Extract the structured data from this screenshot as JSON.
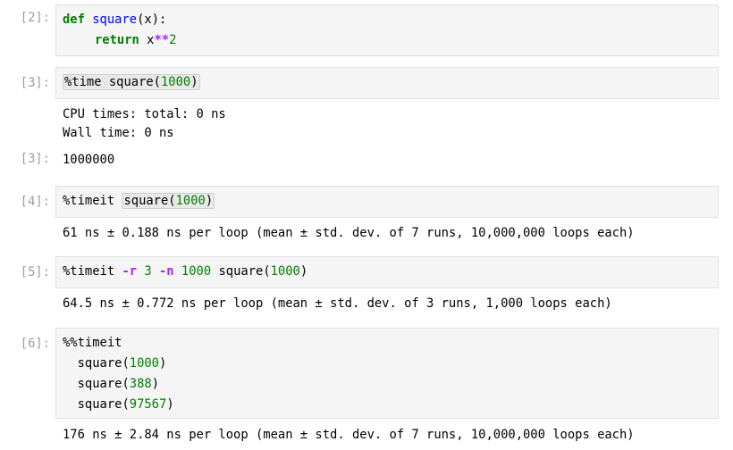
{
  "cells": {
    "c2": {
      "prompt": "[2]:",
      "line1": {
        "kw": "def",
        "fn": "square",
        "rest": "(x):"
      },
      "line2": {
        "kw": "return",
        "var": "x",
        "op": "**",
        "num": "2"
      }
    },
    "c3": {
      "prompt": "[3]:",
      "line1": {
        "magic": "%time square(",
        "num": "1000",
        "close": ")"
      },
      "stdout1": "CPU times: total: 0 ns",
      "stdout2": "Wall time: 0 ns",
      "out_prompt": "[3]:",
      "result": "1000000"
    },
    "c4": {
      "prompt": "[4]:",
      "line1": {
        "magic": "%timeit ",
        "call": "square(",
        "num": "1000",
        "close": ")"
      },
      "stdout1": "61 ns ± 0.188 ns per loop (mean ± std. dev. of 7 runs, 10,000,000 loops each)"
    },
    "c5": {
      "prompt": "[5]:",
      "line1": {
        "magic": "%timeit ",
        "flag_r": "-r ",
        "num_r": "3",
        "sp1": " ",
        "flag_n": "-n ",
        "num_n": "1000",
        "call": " square(",
        "num": "1000",
        "close": ")"
      },
      "stdout1": "64.5 ns ± 0.772 ns per loop (mean ± std. dev. of 3 runs, 1,000 loops each)"
    },
    "c6": {
      "prompt": "[6]:",
      "line1": "%%timeit",
      "line2": {
        "call": "  square(",
        "num": "1000",
        "close": ")"
      },
      "line3": {
        "call": "  square(",
        "num": "388",
        "close": ")"
      },
      "line4": {
        "call": "  square(",
        "num": "97567",
        "close": ")"
      },
      "stdout1": "176 ns ± 2.84 ns per loop (mean ± std. dev. of 7 runs, 10,000,000 loops each)"
    }
  },
  "colors": {
    "keyword": "#008000",
    "function": "#0000ff",
    "number": "#008000",
    "operator": "#aa22ff",
    "prompt": "#9e9e9e",
    "cell_bg": "#f5f5f5"
  }
}
